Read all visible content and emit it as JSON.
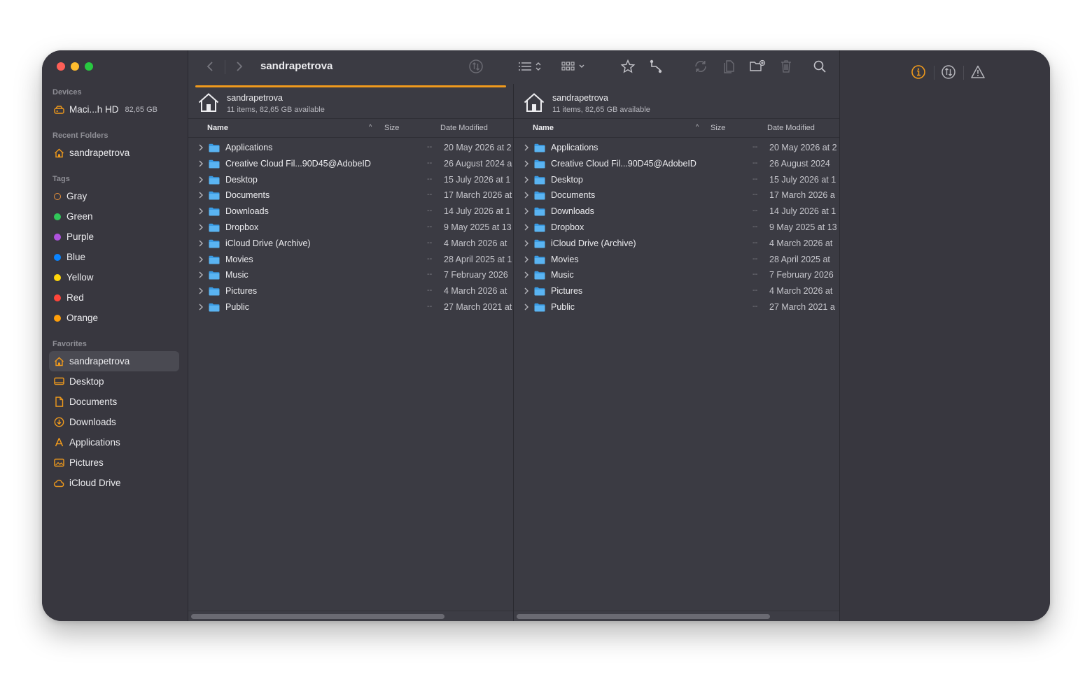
{
  "window": {
    "path_title": "sandrapetrova",
    "accent_color": "#f09a1c"
  },
  "sidebar": {
    "devices_heading": "Devices",
    "device": {
      "name": "Maci...h HD",
      "size": "82,65 GB",
      "icon": "drive-icon"
    },
    "recent_heading": "Recent Folders",
    "recent": [
      {
        "label": "sandrapetrova",
        "icon": "home-icon"
      }
    ],
    "tags_heading": "Tags",
    "tags": [
      {
        "label": "Gray",
        "color": "#e8913a",
        "hollow": true
      },
      {
        "label": "Green",
        "color": "#31c759"
      },
      {
        "label": "Purple",
        "color": "#af52de"
      },
      {
        "label": "Blue",
        "color": "#0a84ff"
      },
      {
        "label": "Yellow",
        "color": "#ffd60a"
      },
      {
        "label": "Red",
        "color": "#ff453a"
      },
      {
        "label": "Orange",
        "color": "#ff9f0a"
      }
    ],
    "favorites_heading": "Favorites",
    "favorites": [
      {
        "label": "sandrapetrova",
        "icon": "home-icon",
        "active": true
      },
      {
        "label": "Desktop",
        "icon": "desktop-icon"
      },
      {
        "label": "Documents",
        "icon": "document-icon"
      },
      {
        "label": "Downloads",
        "icon": "download-icon"
      },
      {
        "label": "Applications",
        "icon": "applications-icon"
      },
      {
        "label": "Pictures",
        "icon": "pictures-icon"
      },
      {
        "label": "iCloud Drive",
        "icon": "cloud-icon"
      }
    ]
  },
  "panes": [
    {
      "title": "sandrapetrova",
      "subtitle": "11 items, 82,65 GB available",
      "columns": {
        "name": "Name",
        "size": "Size",
        "date": "Date Modified"
      },
      "items": [
        {
          "name": "Applications",
          "size": "--",
          "date": "20 May 2026 at 2"
        },
        {
          "name": "Creative Cloud Fil...90D45@AdobeID",
          "size": "--",
          "date": "26 August 2024 a"
        },
        {
          "name": "Desktop",
          "size": "--",
          "date": "15 July 2026 at 1"
        },
        {
          "name": "Documents",
          "size": "--",
          "date": "17 March 2026 at"
        },
        {
          "name": "Downloads",
          "size": "--",
          "date": "14 July 2026 at 1"
        },
        {
          "name": "Dropbox",
          "size": "--",
          "date": "9 May 2025 at 13"
        },
        {
          "name": "iCloud Drive (Archive)",
          "size": "--",
          "date": "4 March 2026 at"
        },
        {
          "name": "Movies",
          "size": "--",
          "date": "28 April 2025 at 1"
        },
        {
          "name": "Music",
          "size": "--",
          "date": "7 February 2026"
        },
        {
          "name": "Pictures",
          "size": "--",
          "date": "4 March 2026 at"
        },
        {
          "name": "Public",
          "size": "--",
          "date": "27 March 2021 at"
        }
      ]
    },
    {
      "title": "sandrapetrova",
      "subtitle": "11 items, 82,65 GB available",
      "columns": {
        "name": "Name",
        "size": "Size",
        "date": "Date Modified"
      },
      "items": [
        {
          "name": "Applications",
          "size": "--",
          "date": "20 May 2026 at 2"
        },
        {
          "name": "Creative Cloud Fil...90D45@AdobeID",
          "size": "--",
          "date": "26 August 2024"
        },
        {
          "name": "Desktop",
          "size": "--",
          "date": "15 July 2026 at 1"
        },
        {
          "name": "Documents",
          "size": "--",
          "date": "17 March 2026 a"
        },
        {
          "name": "Downloads",
          "size": "--",
          "date": "14 July 2026 at 1"
        },
        {
          "name": "Dropbox",
          "size": "--",
          "date": "9 May 2025 at 13"
        },
        {
          "name": "iCloud Drive (Archive)",
          "size": "--",
          "date": "4 March 2026 at"
        },
        {
          "name": "Movies",
          "size": "--",
          "date": "28 April 2025 at"
        },
        {
          "name": "Music",
          "size": "--",
          "date": "7 February 2026"
        },
        {
          "name": "Pictures",
          "size": "--",
          "date": "4 March 2026 at"
        },
        {
          "name": "Public",
          "size": "--",
          "date": "27 March 2021 a"
        }
      ]
    }
  ],
  "toolbar": {
    "icons": [
      "back-icon",
      "forward-icon",
      "sync-status-icon",
      "list-view-icon",
      "grid-view-icon",
      "star-icon",
      "connect-icon",
      "refresh-icon",
      "copy-icon",
      "new-folder-icon",
      "trash-icon",
      "search-icon"
    ]
  },
  "inspector": {
    "icons": [
      "info-icon",
      "transfer-icon",
      "warning-icon"
    ]
  }
}
